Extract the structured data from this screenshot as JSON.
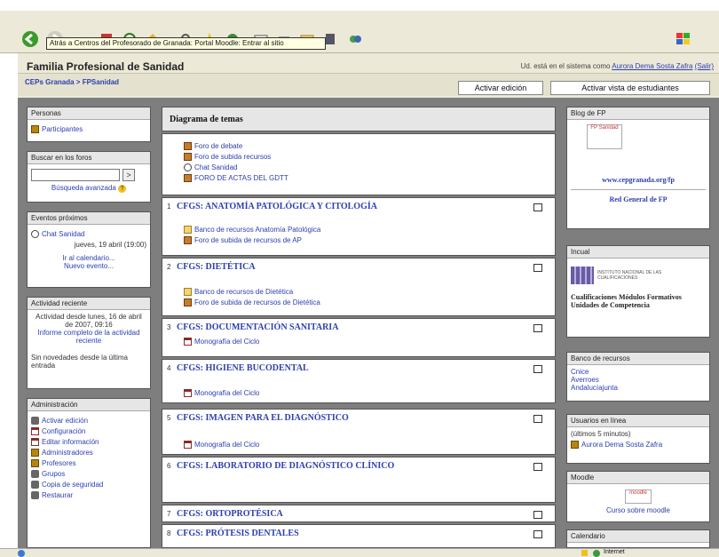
{
  "browser": {
    "tooltip": "Atrás a Centros del Profesorado de Granada: Portal Moodle: Entrar al sitio",
    "status": "Internet"
  },
  "header": {
    "site_title": "Familia Profesional de Sanidad",
    "login_prefix": "Ud. está en el sistema como",
    "login_user": "Aurora Dema Sosta Zafra",
    "logout": "(Salir)",
    "breadcrumb": "CEPs Granada > FPSanidad",
    "activar_edicion": "Activar edición",
    "activar_vista": "Activar vista de estudiantes"
  },
  "left": {
    "personas": {
      "title": "Personas",
      "participantes": "Participantes"
    },
    "buscar": {
      "title": "Buscar en los foros",
      "go": ">",
      "avanzada": "Búsqueda avanzada"
    },
    "eventos": {
      "title": "Eventos próximos",
      "chat": "Chat Sanidad",
      "fecha": "jueves, 19 abril (19:00)",
      "calendario": "Ir al calendario...",
      "nuevo": "Nuevo evento..."
    },
    "actividad": {
      "title": "Actividad reciente",
      "desde": "Actividad desde lunes, 16 de abril de 2007, 09:16",
      "informe": "Informe completo de la actividad reciente",
      "nada": "Sin novedades desde la última entrada"
    },
    "admin": {
      "title": "Administración",
      "items": [
        "Activar edición",
        "Configuración",
        "Editar información",
        "Administradores",
        "Profesores",
        "Grupos",
        "Copia de seguridad",
        "Restaurar"
      ]
    }
  },
  "center": {
    "title": "Diagrama de temas",
    "top_items": [
      "Foro de debate",
      "Foro de subida recursos",
      "Chat Sanidad",
      "FORO DE ACTAS DEL GDTT"
    ],
    "sections": [
      {
        "num": "1",
        "title": "CFGS:     ANATOMÍA PATOLÓGICA Y CITOLOGÍA",
        "items": [
          "Banco de recursos Anatomía Patológica",
          "Foro de subida de recursos de AP"
        ]
      },
      {
        "num": "2",
        "title": "CFGS: DIETÉTICA",
        "items": [
          "Banco de recursos de Dietética",
          "Foro de subida de recursos de Dietética"
        ]
      },
      {
        "num": "3",
        "title": "CFGS:  DOCUMENTACIÓN SANITARIA",
        "items": [
          "Monografía del Ciclo"
        ]
      },
      {
        "num": "4",
        "title": "CFGS: HIGIENE BUCODENTAL",
        "items": [
          "Monografía del Ciclo"
        ]
      },
      {
        "num": "5",
        "title": "CFGS: IMAGEN PARA EL DIAGNÓSTICO",
        "items": [
          "Monografía del Ciclo"
        ]
      },
      {
        "num": "6",
        "title": "CFGS: LABORATORIO DE DIAGNÓSTICO CLÍNICO",
        "items": []
      },
      {
        "num": "7",
        "title": "CFGS: ORTOPROTÉSICA",
        "items": []
      },
      {
        "num": "8",
        "title": "CFGS: PRÓTESIS DENTALES",
        "items": []
      }
    ]
  },
  "right": {
    "blog": {
      "title": "Blog de FP",
      "img": "FP Sanidad",
      "url": "www.cepgranada.org/fp",
      "red": "Red General de FP"
    },
    "incual": {
      "title": "Incual",
      "logo": "INSTITUTO NACIONAL DE LAS CUALIFICACIONES",
      "text": "Cualificaciones Módulos Formativos Unidades de Competencia"
    },
    "banco": {
      "title": "Banco de recursos",
      "items": [
        "Cnice",
        "Averroes",
        "Andalucíajunta"
      ]
    },
    "usuarios": {
      "title": "Usuarios en línea",
      "sub": "(últimos 5 minutos)",
      "user": "Aurora Dema Sosta Zafra"
    },
    "moodle": {
      "title": "Moodle",
      "img": "moodle",
      "curso": "Curso sobre moodle"
    },
    "calendario": {
      "title": "Calendario"
    }
  }
}
